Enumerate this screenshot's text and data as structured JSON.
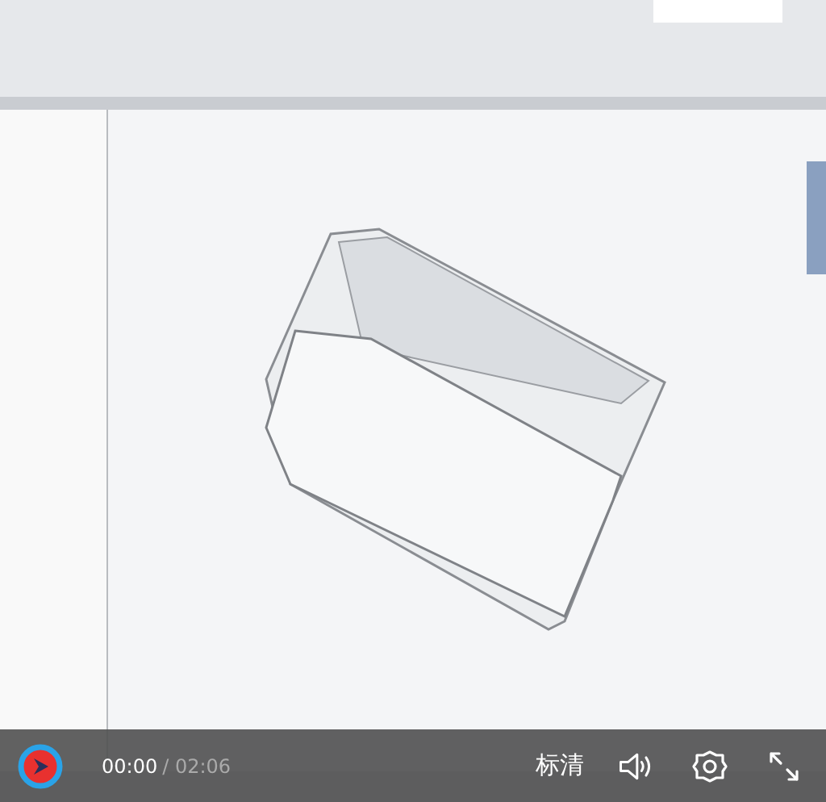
{
  "controls": {
    "current_time": "00:00",
    "duration": "/ 02:06",
    "quality": "标清"
  }
}
